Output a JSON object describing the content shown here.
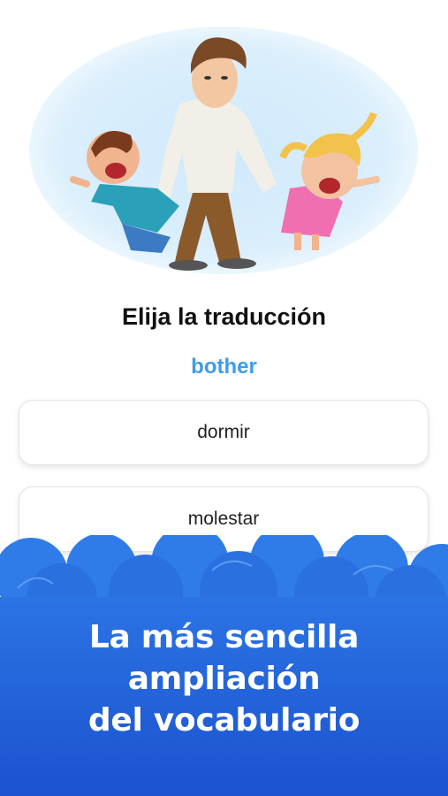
{
  "quiz": {
    "prompt": "Elija la traducción",
    "word": "bother",
    "options": [
      {
        "label": "dormir"
      },
      {
        "label": "molestar"
      }
    ]
  },
  "banner": {
    "lines": [
      "La más sencilla",
      "ampliación",
      "del vocabulario"
    ]
  },
  "colors": {
    "accent": "#3e9bec",
    "banner_blue": "#1f5bd6"
  },
  "illustration": {
    "subject": "father-with-two-crying-children-illustration"
  }
}
